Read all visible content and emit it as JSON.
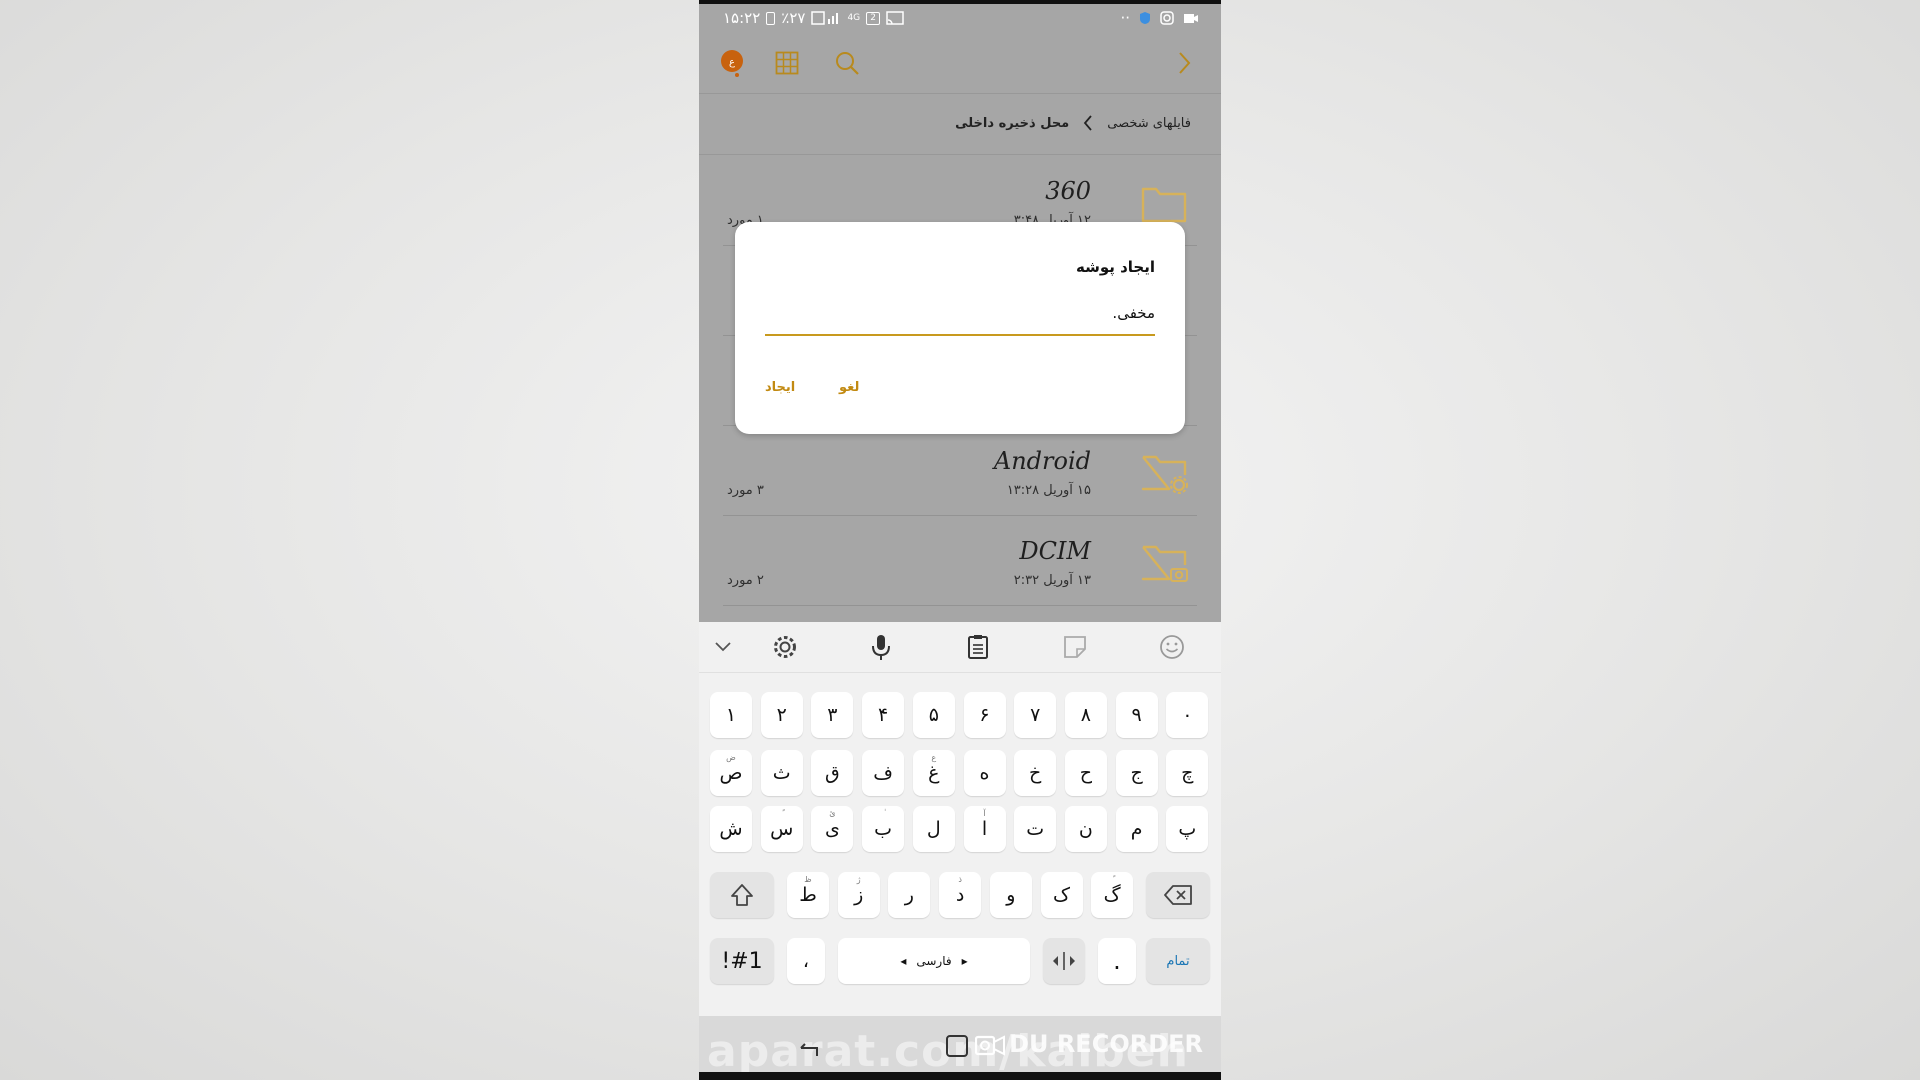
{
  "status_bar": {
    "time": "۱۵:۲۲",
    "battery": "٪۲۷",
    "network": "4G",
    "sim": "2",
    "dots": "··"
  },
  "breadcrumb": {
    "root": "فایلهای شخصی",
    "current": "محل ذخیره داخلی"
  },
  "files": [
    {
      "name": "360",
      "date": "۱۲ آوریل ۳:۴۸",
      "count": "۱ مورد",
      "icon": "folder-icon"
    },
    {
      "name": "Android",
      "date": "۱۵ آوریل ۱۳:۲۸",
      "count": "۳ مورد",
      "icon": "folder-settings-icon"
    },
    {
      "name": "DCIM",
      "date": "۱۳ آوریل ۲:۳۲",
      "count": "۲ مورد",
      "icon": "folder-camera-icon"
    }
  ],
  "dialog": {
    "title": "ایجاد پوشه",
    "input_value": ".مخفی",
    "cancel_label": "لغو",
    "create_label": "ایجاد"
  },
  "keyboard": {
    "row_numbers": [
      "۱",
      "۲",
      "۳",
      "۴",
      "۵",
      "۶",
      "۷",
      "۸",
      "۹",
      "۰"
    ],
    "row1": [
      "ص",
      "ث",
      "ق",
      "ف",
      "غ",
      "ه",
      "خ",
      "ح",
      "ج",
      "چ"
    ],
    "row1_hints": [
      "ض",
      "",
      "",
      "",
      "ع",
      "",
      "",
      "",
      "",
      ""
    ],
    "row2": [
      "ش",
      "س",
      "ی",
      "ب",
      "ل",
      "ا",
      "ت",
      "ن",
      "م",
      "پ"
    ],
    "row2_hints": [
      "",
      "ً",
      "ئ",
      "ٰ",
      "",
      "آ",
      "",
      "",
      "",
      ""
    ],
    "row3": [
      "ط",
      "ز",
      "ر",
      "د",
      "و",
      "ک",
      "گ"
    ],
    "row3_hints": [
      "ظ",
      "ژ",
      "",
      "ذ",
      "",
      "",
      "ً"
    ],
    "symbols_label": "!#1",
    "comma_label": "،",
    "space_label": "فارسی",
    "period_label": ".",
    "done_label": "تمام"
  },
  "watermark": "aparat.com/kalbeh_",
  "recorder": "DU RECORDER",
  "colors": {
    "accent": "#c89a1e",
    "folder": "#d7b25a",
    "avatar": "#c8620e",
    "done": "#1d77b5"
  }
}
